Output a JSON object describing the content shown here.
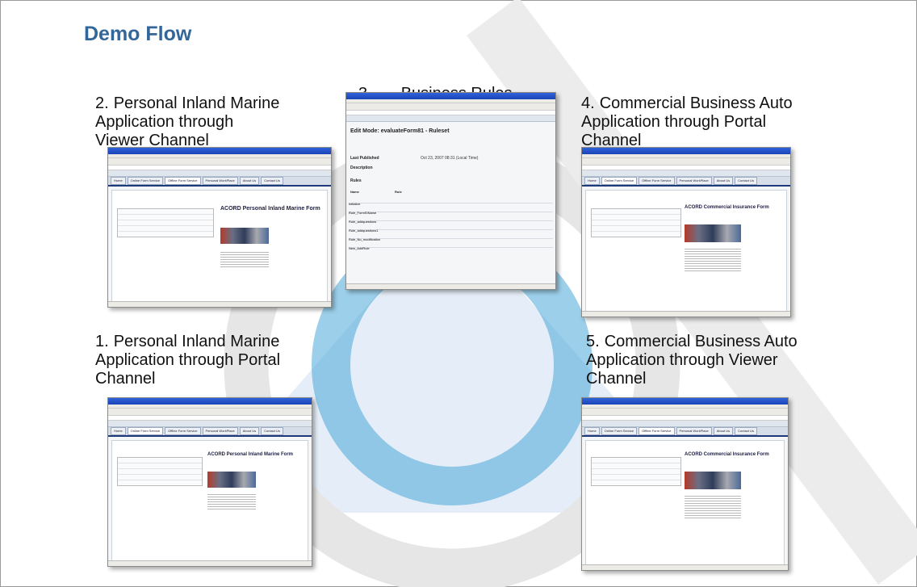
{
  "slide": {
    "title": "Demo Flow",
    "steps": [
      {
        "num": "1.",
        "label": "Personal Inland Marine\nApplication through Portal\nChannel"
      },
      {
        "num": "2.",
        "label": "Personal Inland Marine\nApplication through\nViewer Channel"
      },
      {
        "num": "3.",
        "label": "Business Rules"
      },
      {
        "num": "4.",
        "label": "Commercial Business Auto\nApplication through Portal\nChannel"
      },
      {
        "num": "5.",
        "label": "Commercial Business Auto\nApplication through Viewer\nChannel"
      }
    ]
  },
  "screens": {
    "portal_tabs": [
      "Home",
      "Online Form Service",
      "Offline Form Service",
      "Personal WorkPlace",
      "About Us",
      "Contact Us"
    ],
    "personal_form_title": "ACORD Personal Inland Marine Form",
    "commercial_form_title": "ACORD Commercial Insurance Form",
    "rules": {
      "header": "Edit Mode: evaluateForm81 - Ruleset",
      "last_published_label": "Last Published",
      "last_published_value": "Oct 23, 2007 08:31 (Local Time)",
      "description_label": "Description",
      "rules_label": "Rules",
      "col_name": "Name",
      "col_rule": "Rule",
      "rows": [
        "Initialize",
        "Rule_FormSIName",
        "Rule_addquestions",
        "Rule_addquestions1",
        "Rule_No_modification",
        "New_AddRule"
      ]
    }
  }
}
